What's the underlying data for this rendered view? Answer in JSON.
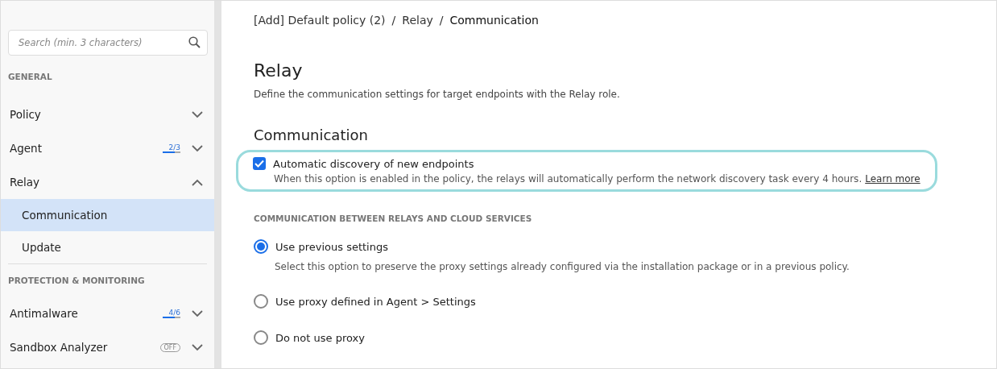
{
  "sidebar": {
    "search": {
      "placeholder": "Search (min. 3 characters)"
    },
    "sections": [
      {
        "title": "GENERAL",
        "items": [
          {
            "label": "Policy",
            "expanded": false
          },
          {
            "label": "Agent",
            "expanded": false,
            "progress": {
              "text": "2/3",
              "level": 0.6667
            }
          },
          {
            "label": "Relay",
            "expanded": true,
            "children": [
              {
                "label": "Communication",
                "selected": true
              },
              {
                "label": "Update",
                "selected": false
              }
            ]
          }
        ]
      },
      {
        "title": "PROTECTION & MONITORING",
        "items": [
          {
            "label": "Antimalware",
            "expanded": false,
            "progress": {
              "text": "4/6",
              "level": 0.6667
            }
          },
          {
            "label": "Sandbox Analyzer",
            "expanded": false,
            "status": "OFF"
          }
        ]
      }
    ]
  },
  "breadcrumb": {
    "separator": "/",
    "items": [
      "[Add] Default policy (2)",
      "Relay",
      "Communication"
    ]
  },
  "page": {
    "title": "Relay",
    "description": "Define the communication settings for target endpoints with the Relay role.",
    "section_title": "Communication",
    "checkbox": {
      "label": "Automatic discovery of new endpoints",
      "checked": true,
      "highlighted": true,
      "description": "When this option is enabled in the policy, the relays will automatically perform the network discovery task every 4 hours.",
      "link": "Learn more"
    },
    "group_title": "COMMUNICATION BETWEEN RELAYS AND CLOUD SERVICES",
    "options": [
      {
        "label": "Use previous settings",
        "selected": true,
        "description": "Select this option to preserve the proxy settings already configured via the installation package or in a previous policy."
      },
      {
        "label": "Use proxy defined in Agent > Settings",
        "selected": false
      },
      {
        "label": "Do not use proxy",
        "selected": false
      }
    ]
  }
}
